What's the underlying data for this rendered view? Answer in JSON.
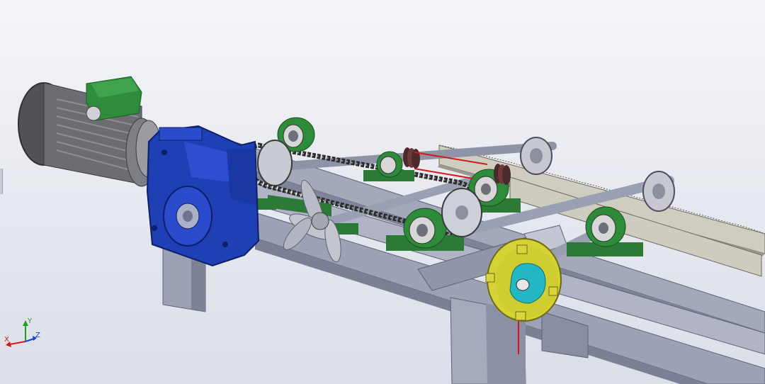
{
  "triad": {
    "x_label": "X",
    "y_label": "Y",
    "z_label": "Z"
  },
  "colors": {
    "background_top": "#f4f5f8",
    "background_bottom": "#dcdfe8",
    "frame": "#9499ad",
    "frame_dark": "#6f7489",
    "gearbox": "#1f3fb5",
    "motor_body": "#5a5c60",
    "terminal_box": "#2f8c3c",
    "bearing_housing": "#2e8b3a",
    "chain": "#3a3a3a",
    "cam_plate": "#d4d234",
    "cam": "#22b7c2",
    "rack": "#c9c6b8",
    "wire": "#d11a1a",
    "axis_x": "#d11a1a",
    "axis_y": "#1aa01a",
    "axis_z": "#1a3fd1"
  }
}
